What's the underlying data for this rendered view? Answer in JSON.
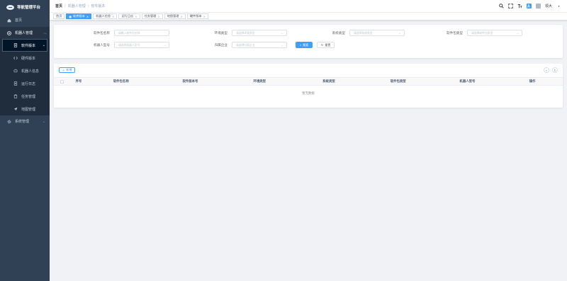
{
  "app": {
    "title": "导航管理平台"
  },
  "sidebar": {
    "items": [
      {
        "label": "首页"
      },
      {
        "label": "机器人管理"
      },
      {
        "label": "系统管理"
      }
    ],
    "sub_items": [
      {
        "label": "软件版本"
      },
      {
        "label": "硬件版本"
      },
      {
        "label": "机器人信息"
      },
      {
        "label": "运行日志"
      },
      {
        "label": "任务管理"
      },
      {
        "label": "地图管理"
      }
    ]
  },
  "breadcrumb": [
    "首页",
    "机器人管理",
    "软件版本"
  ],
  "navbar": {
    "user": "领大"
  },
  "tags": [
    {
      "label": "首页"
    },
    {
      "label": "软件版本"
    },
    {
      "label": "机器人信息"
    },
    {
      "label": "运行日志"
    },
    {
      "label": "任务管理"
    },
    {
      "label": "地图管理"
    },
    {
      "label": "硬件版本"
    }
  ],
  "search": {
    "fields": [
      {
        "label": "软件包名称",
        "placeholder": "请输入软件包名称"
      },
      {
        "label": "环境类型",
        "placeholder": "请选择环境类型"
      },
      {
        "label": "系统类型",
        "placeholder": "请选择系统类型"
      },
      {
        "label": "软件包类型",
        "placeholder": "请选择软件包类型"
      },
      {
        "label": "机器人型号",
        "placeholder": "请选择机器人型号"
      },
      {
        "label": "归属企业",
        "placeholder": "请选择归属企业"
      }
    ],
    "search_label": "搜索",
    "reset_label": "重置"
  },
  "table": {
    "add_label": "新增",
    "columns": [
      "序号",
      "软件包名称",
      "软件版本号",
      "环境类型",
      "系统类型",
      "软件包类型",
      "机器人型号",
      "操作"
    ],
    "empty_text": "暂无数据"
  }
}
